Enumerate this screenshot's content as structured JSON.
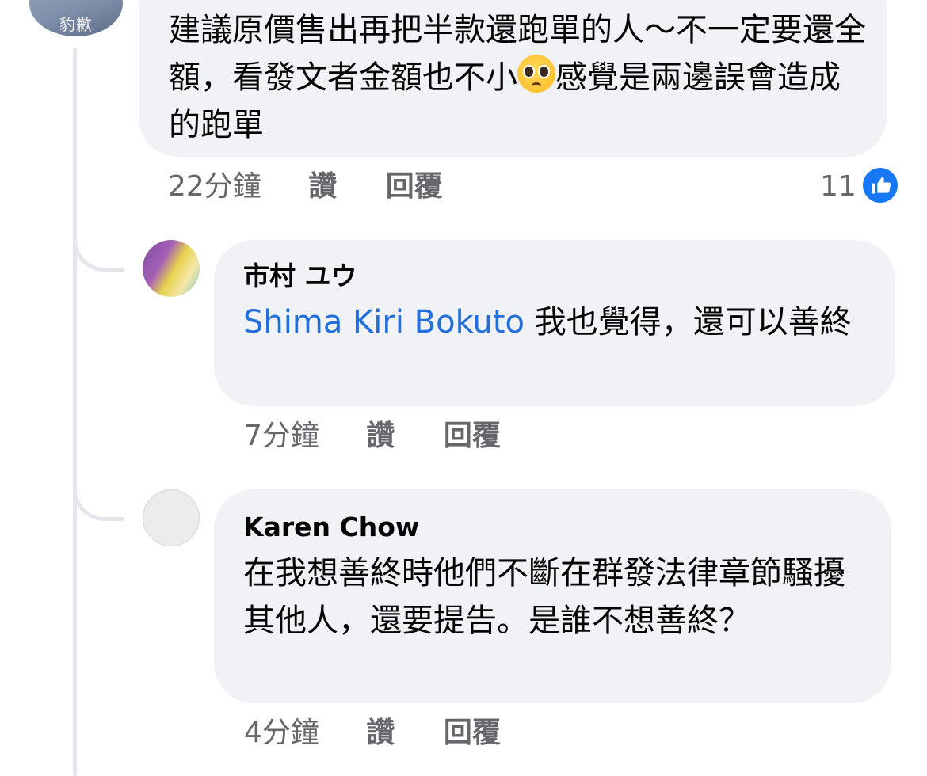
{
  "thread": {
    "top_comment": {
      "avatar_text": "豹歉",
      "body": "建議原價售出再把半款還跑單的人～不一定要還全額，看發文者金額也不小",
      "body_after_emoji": "感覺是兩邊誤會造成的跑單",
      "emoji": "pleading-face",
      "time": "22分鐘",
      "like_label": "讚",
      "reply_label": "回覆",
      "reaction_count": "11",
      "reaction_icon": "like-thumb",
      "reaction_color": "#1877f2"
    },
    "replies": [
      {
        "author": "市村 ユウ",
        "mention": "Shima Kiri Bokuto",
        "body": " 我也覺得，還可以善終",
        "time": "7分鐘",
        "like_label": "讚",
        "reply_label": "回覆"
      },
      {
        "author": "Karen Chow",
        "body": "在我想善終時他們不斷在群發法律章節騷擾其他人，還要提告。是誰不想善終？",
        "time": "4分鐘",
        "like_label": "讚",
        "reply_label": "回覆"
      }
    ]
  },
  "colors": {
    "bubble": "#f0f2f5",
    "mention": "#216fdb",
    "secondary_text": "#65676b",
    "thread_line": "#e4e6eb"
  }
}
